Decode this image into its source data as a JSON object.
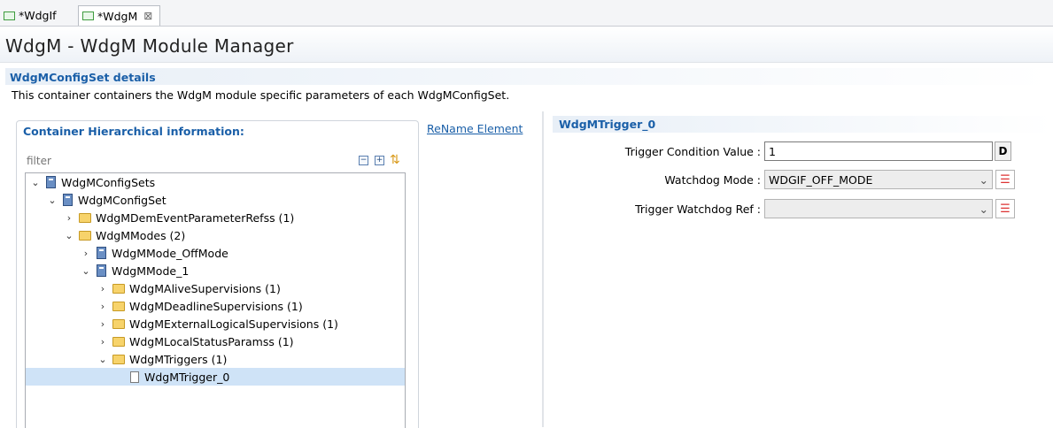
{
  "tabs": [
    {
      "label": "*WdgIf",
      "icon": "module-icon"
    },
    {
      "label": "*WdgM",
      "icon": "module-icon",
      "close": "⊠"
    }
  ],
  "header": {
    "title": "WdgM - WdgM Module Manager"
  },
  "section": {
    "title": "WdgMConfigSet details",
    "description": "This container containers the WdgM module specific parameters of each WdgMConfigSet."
  },
  "left": {
    "heading": "Container Hierarchical information:",
    "rename": "ReName Element",
    "filter_placeholder": "filter",
    "tree": [
      {
        "label": "WdgMConfigSets",
        "chev": "⌄",
        "icon": "container"
      },
      {
        "label": "WdgMConfigSet",
        "chev": "⌄",
        "icon": "container"
      },
      {
        "label": "WdgMDemEventParameterRefss (1)",
        "chev": "›",
        "icon": "folder"
      },
      {
        "label": "WdgMModes (2)",
        "chev": "⌄",
        "icon": "folder"
      },
      {
        "label": "WdgMMode_OffMode",
        "chev": "›",
        "icon": "container"
      },
      {
        "label": "WdgMMode_1",
        "chev": "⌄",
        "icon": "container"
      },
      {
        "label": "WdgMAliveSupervisions (1)",
        "chev": "›",
        "icon": "folder"
      },
      {
        "label": "WdgMDeadlineSupervisions (1)",
        "chev": "›",
        "icon": "folder"
      },
      {
        "label": "WdgMExternalLogicalSupervisions (1)",
        "chev": "›",
        "icon": "folder"
      },
      {
        "label": "WdgMLocalStatusParamss (1)",
        "chev": "›",
        "icon": "folder"
      },
      {
        "label": "WdgMTriggers (1)",
        "chev": "⌄",
        "icon": "folder"
      },
      {
        "label": "WdgMTrigger_0",
        "chev": "",
        "icon": "param"
      }
    ]
  },
  "right": {
    "heading": "WdgMTrigger_0",
    "trigger_condition_label": "Trigger Condition Value :",
    "trigger_condition_value": "1",
    "d_button": "D",
    "watchdog_mode_label": "Watchdog Mode :",
    "watchdog_mode_value": "WDGIF_OFF_MODE",
    "trigger_ref_label": "Trigger Watchdog Ref :",
    "trigger_ref_value": ""
  }
}
